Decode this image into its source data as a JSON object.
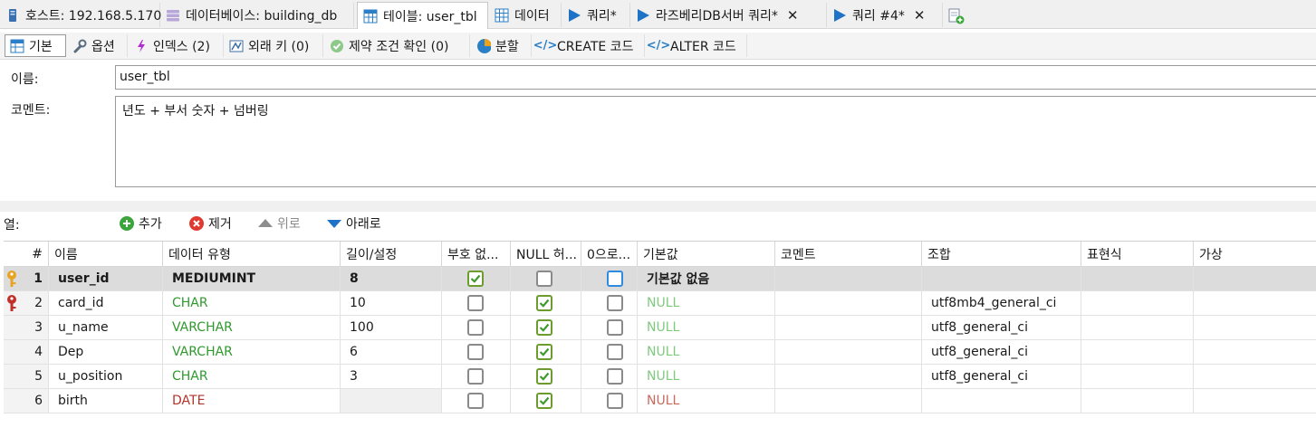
{
  "tabs": [
    {
      "label": "호스트: 192.168.5.170",
      "icon": "server-icon"
    },
    {
      "label": "데이터베이스: building_db",
      "icon": "database-icon"
    },
    {
      "label": "테이블: user_tbl",
      "icon": "table-icon"
    },
    {
      "label": "데이터",
      "icon": "grid-icon"
    },
    {
      "label": "쿼리*",
      "icon": "play-icon"
    },
    {
      "label": "라즈베리DB서버 쿼리*",
      "icon": "play-icon"
    },
    {
      "label": "쿼리 #4*",
      "icon": "play-icon"
    }
  ],
  "tab_close_glyph": "✕",
  "subtabs": [
    {
      "label": "기본",
      "icon": "table-icon"
    },
    {
      "label": "옵션",
      "icon": "wrench-icon"
    },
    {
      "label": "인덱스 (2)",
      "icon": "lightning-icon"
    },
    {
      "label": "외래 키 (0)",
      "icon": "foreign-key-icon"
    },
    {
      "label": "제약 조건 확인 (0)",
      "icon": "check-icon"
    },
    {
      "label": "분할",
      "icon": "pie-icon"
    },
    {
      "label": "CREATE 코드",
      "icon": "code-icon"
    },
    {
      "label": "ALTER 코드",
      "icon": "code-icon"
    }
  ],
  "form": {
    "name_label": "이름:",
    "name_value": "user_tbl",
    "comment_label": "코멘트:",
    "comment_value": "년도 + 부서 숫자 + 넘버링"
  },
  "columns_toolbar": {
    "label": "열:",
    "add": "추가",
    "remove": "제거",
    "up": "위로",
    "down": "아래로"
  },
  "grid": {
    "headers": [
      "#",
      "이름",
      "데이터 유형",
      "길이/설정",
      "부호 없...",
      "NULL 허...",
      "0으로...",
      "기본값",
      "코멘트",
      "조합",
      "표현식",
      "가상"
    ],
    "rows": [
      {
        "num": "1",
        "name": "user_id",
        "type": "MEDIUMINT",
        "length": "8",
        "unsigned": true,
        "nullable": false,
        "zerofill": false,
        "default": "기본값 없음",
        "comment": "",
        "collation": "",
        "key": "primary-key-icon",
        "type_color": "#1a1a1a"
      },
      {
        "num": "2",
        "name": "card_id",
        "type": "CHAR",
        "length": "10",
        "unsigned": false,
        "nullable": true,
        "zerofill": false,
        "default": "NULL",
        "comment": "",
        "collation": "utf8mb4_general_ci",
        "key": "unique-key-icon",
        "type_color": "#2e9a2e"
      },
      {
        "num": "3",
        "name": "u_name",
        "type": "VARCHAR",
        "length": "100",
        "unsigned": false,
        "nullable": true,
        "zerofill": false,
        "default": "NULL",
        "comment": "",
        "collation": "utf8_general_ci",
        "key": "",
        "type_color": "#2e9a2e"
      },
      {
        "num": "4",
        "name": "Dep",
        "type": "VARCHAR",
        "length": "6",
        "unsigned": false,
        "nullable": true,
        "zerofill": false,
        "default": "NULL",
        "comment": "",
        "collation": "utf8_general_ci",
        "key": "",
        "type_color": "#2e9a2e"
      },
      {
        "num": "5",
        "name": "u_position",
        "type": "CHAR",
        "length": "3",
        "unsigned": false,
        "nullable": true,
        "zerofill": false,
        "default": "NULL",
        "comment": "",
        "collation": "utf8_general_ci",
        "key": "",
        "type_color": "#2e9a2e"
      },
      {
        "num": "6",
        "name": "birth",
        "type": "DATE",
        "length": "",
        "unsigned": false,
        "nullable": true,
        "zerofill": false,
        "default": "NULL",
        "comment": "",
        "collation": "",
        "key": "",
        "type_color": "#b5342c"
      }
    ]
  },
  "colors": {
    "accent": "#2f8ae0",
    "string_type": "#2e9a2e",
    "date_type": "#b5342c",
    "selected_row": "#dcdcdc"
  }
}
